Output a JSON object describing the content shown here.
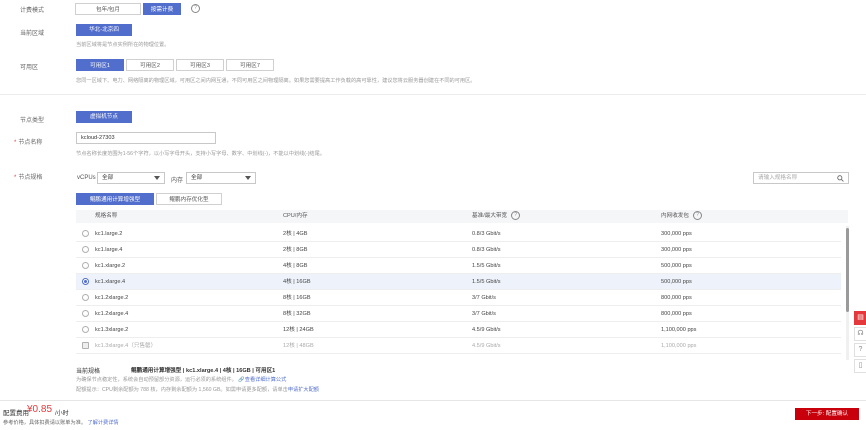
{
  "billing": {
    "label": "计费模式",
    "options": [
      "包年/包月",
      "按需计费"
    ],
    "help": "?"
  },
  "region": {
    "label": "当前区域",
    "value": "华北-北京四",
    "hint": "当前区域将是节点实例所在的物理位置。"
  },
  "az": {
    "label": "可用区",
    "options": [
      "可用区1",
      "可用区2",
      "可用区3",
      "可用区7"
    ],
    "hint": "您同一区域下、电力、网络隔离的物理区域，可用区之间内网互通，不同可用区之间物理隔离。如果您需要提高工作负载的高可靠性，建议您将云服务器创建在不同的可用区。"
  },
  "node_type": {
    "label": "节点类型",
    "value": "虚拟机节点"
  },
  "node_name": {
    "label": "节点名称",
    "value": "kcloud-27303",
    "hint": "节点名称长度范围为1-56个字符，以小写字母开头，支持小写字母、数字、中划线(-)，不能以中划线(-)结尾。"
  },
  "flavor": {
    "label": "节点规格",
    "vcpu_label": "vCPUs",
    "vcpu_value": "全部",
    "mem_label": "内存",
    "mem_value": "全部",
    "search_placeholder": "请输入规格名称",
    "tabs": [
      "鲲鹏通用计算增强型",
      "鲲鹏内存优化型"
    ],
    "columns": {
      "name": "规格名称",
      "cpu": "CPU/内存",
      "bandwidth": "基准/最大带宽",
      "pps": "内网收发包"
    },
    "rows": [
      {
        "name": "kc1.large.2",
        "cpu": "2核 | 4GB",
        "bw": "0.8/3 Gbit/s",
        "pps": "300,000 pps"
      },
      {
        "name": "kc1.large.4",
        "cpu": "2核 | 8GB",
        "bw": "0.8/3 Gbit/s",
        "pps": "300,000 pps"
      },
      {
        "name": "kc1.xlarge.2",
        "cpu": "4核 | 8GB",
        "bw": "1.5/5 Gbit/s",
        "pps": "500,000 pps"
      },
      {
        "name": "kc1.xlarge.4",
        "cpu": "4核 | 16GB",
        "bw": "1.5/5 Gbit/s",
        "pps": "500,000 pps"
      },
      {
        "name": "kc1.2xlarge.2",
        "cpu": "8核 | 16GB",
        "bw": "3/7 Gbit/s",
        "pps": "800,000 pps"
      },
      {
        "name": "kc1.2xlarge.4",
        "cpu": "8核 | 32GB",
        "bw": "3/7 Gbit/s",
        "pps": "800,000 pps"
      },
      {
        "name": "kc1.3xlarge.2",
        "cpu": "12核 | 24GB",
        "bw": "4.5/9 Gbit/s",
        "pps": "1,100,000 pps"
      },
      {
        "name": "kc1.3xlarge.4（只售罄）",
        "cpu": "12核 | 48GB",
        "bw": "4.5/9 Gbit/s",
        "pps": "1,100,000 pps"
      }
    ],
    "current_label": "当前规格",
    "current_value": "鲲鹏通用计算增强型 | kc1.xlarge.4 | 4核 | 16GB | 可用区1",
    "current_hint": "为确保节点稳定性，系统会自动预留部分资源，运行必须的系统组件。",
    "current_link": "查看详细计算公式",
    "quota_hint": "配额提示：CPU剩余配额为 788 核，内存剩余配额为 1,560 GB。如需申请更多配额，请单击",
    "quota_link": "申请扩大配额"
  },
  "footer": {
    "price_label": "配置费用",
    "price_value": "¥0.85",
    "price_unit": "/小时",
    "note": "参考价格，具体扣费请以账单为准。",
    "note_link": "了解计费详情",
    "next_button": "下一步: 配置确认"
  },
  "side": {
    "icons": [
      "chat-icon",
      "headset-icon",
      "help-icon",
      "doc-icon"
    ]
  },
  "colors": {
    "primary": "#526ecc",
    "price": "#e4393c",
    "next": "#c7000b"
  }
}
